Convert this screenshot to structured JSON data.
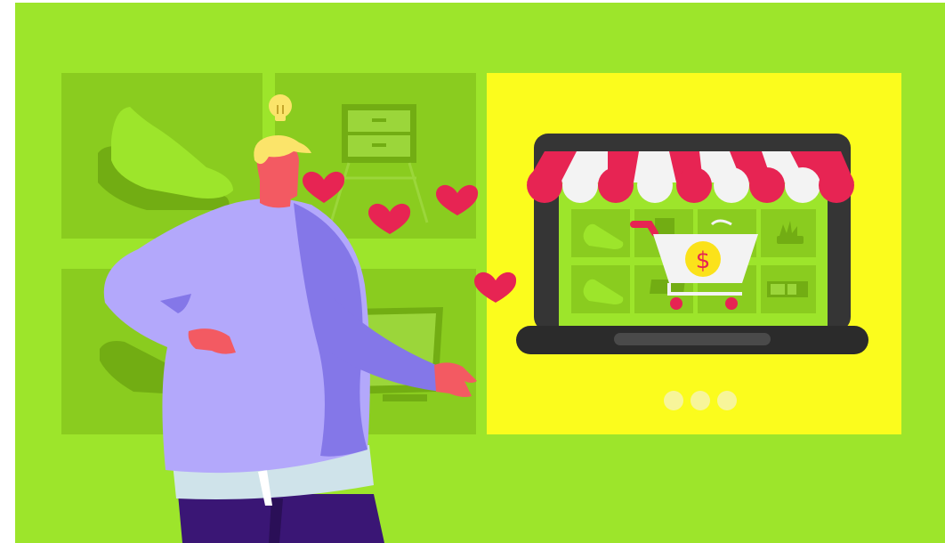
{
  "scene": {
    "cart_symbol": "$",
    "carousel_dots": 3,
    "colors": {
      "background": "#9de52b",
      "tile": "#8acc1f",
      "tile_shape": "#72ad13",
      "highlight_panel": "#fbfc1d",
      "laptop": "#353535",
      "awning_red": "#e72453",
      "awning_white": "#f3f3f3",
      "heart": "#e72453",
      "sweater": "#b3a8fb",
      "sweater_shadow": "#8477e8",
      "skin": "#f35a62",
      "hair": "#fbe46a",
      "pants": "#3a1675",
      "coin": "#fbe21a"
    },
    "icons": [
      "lightbulb-icon",
      "heart-icon",
      "shopping-cart-icon",
      "dollar-icon",
      "shoe-icon",
      "drawer-cabinet-icon",
      "plant-icon",
      "tv-icon"
    ]
  }
}
